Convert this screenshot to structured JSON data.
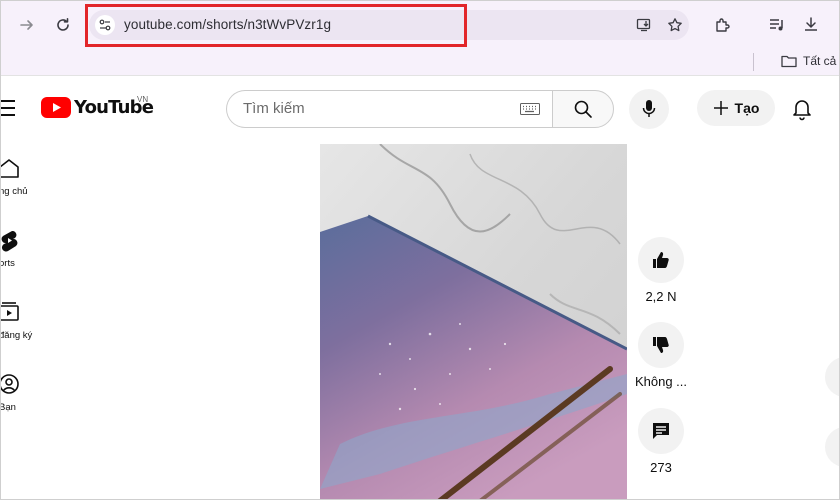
{
  "browser": {
    "url": "youtube.com/shorts/n3tWvPVzr1g",
    "bookmark_folder": "Tất cả",
    "icons": [
      "forward-icon",
      "reload-icon",
      "site-info-icon",
      "install-app-icon",
      "bookmark-star-icon",
      "extensions-icon",
      "media-control-icon",
      "download-icon",
      "more-vertical-icon",
      "folder-icon"
    ],
    "highlight_color": "#e2262a"
  },
  "youtube": {
    "logo_text": "YouTube",
    "country_code": "VN",
    "search_placeholder": "Tìm kiếm",
    "create_label": "Tạo",
    "brand_red": "#ff0000"
  },
  "sidebar": {
    "items": [
      {
        "label": "ng chủ",
        "icon": "home-icon"
      },
      {
        "label": "orts",
        "icon": "shorts-icon"
      },
      {
        "label": "đăng ký",
        "icon": "subscriptions-icon"
      },
      {
        "label": "Bạn",
        "icon": "you-icon"
      }
    ]
  },
  "short": {
    "likes": "2,2 N",
    "dislike_label": "Không ...",
    "comments": "273"
  }
}
